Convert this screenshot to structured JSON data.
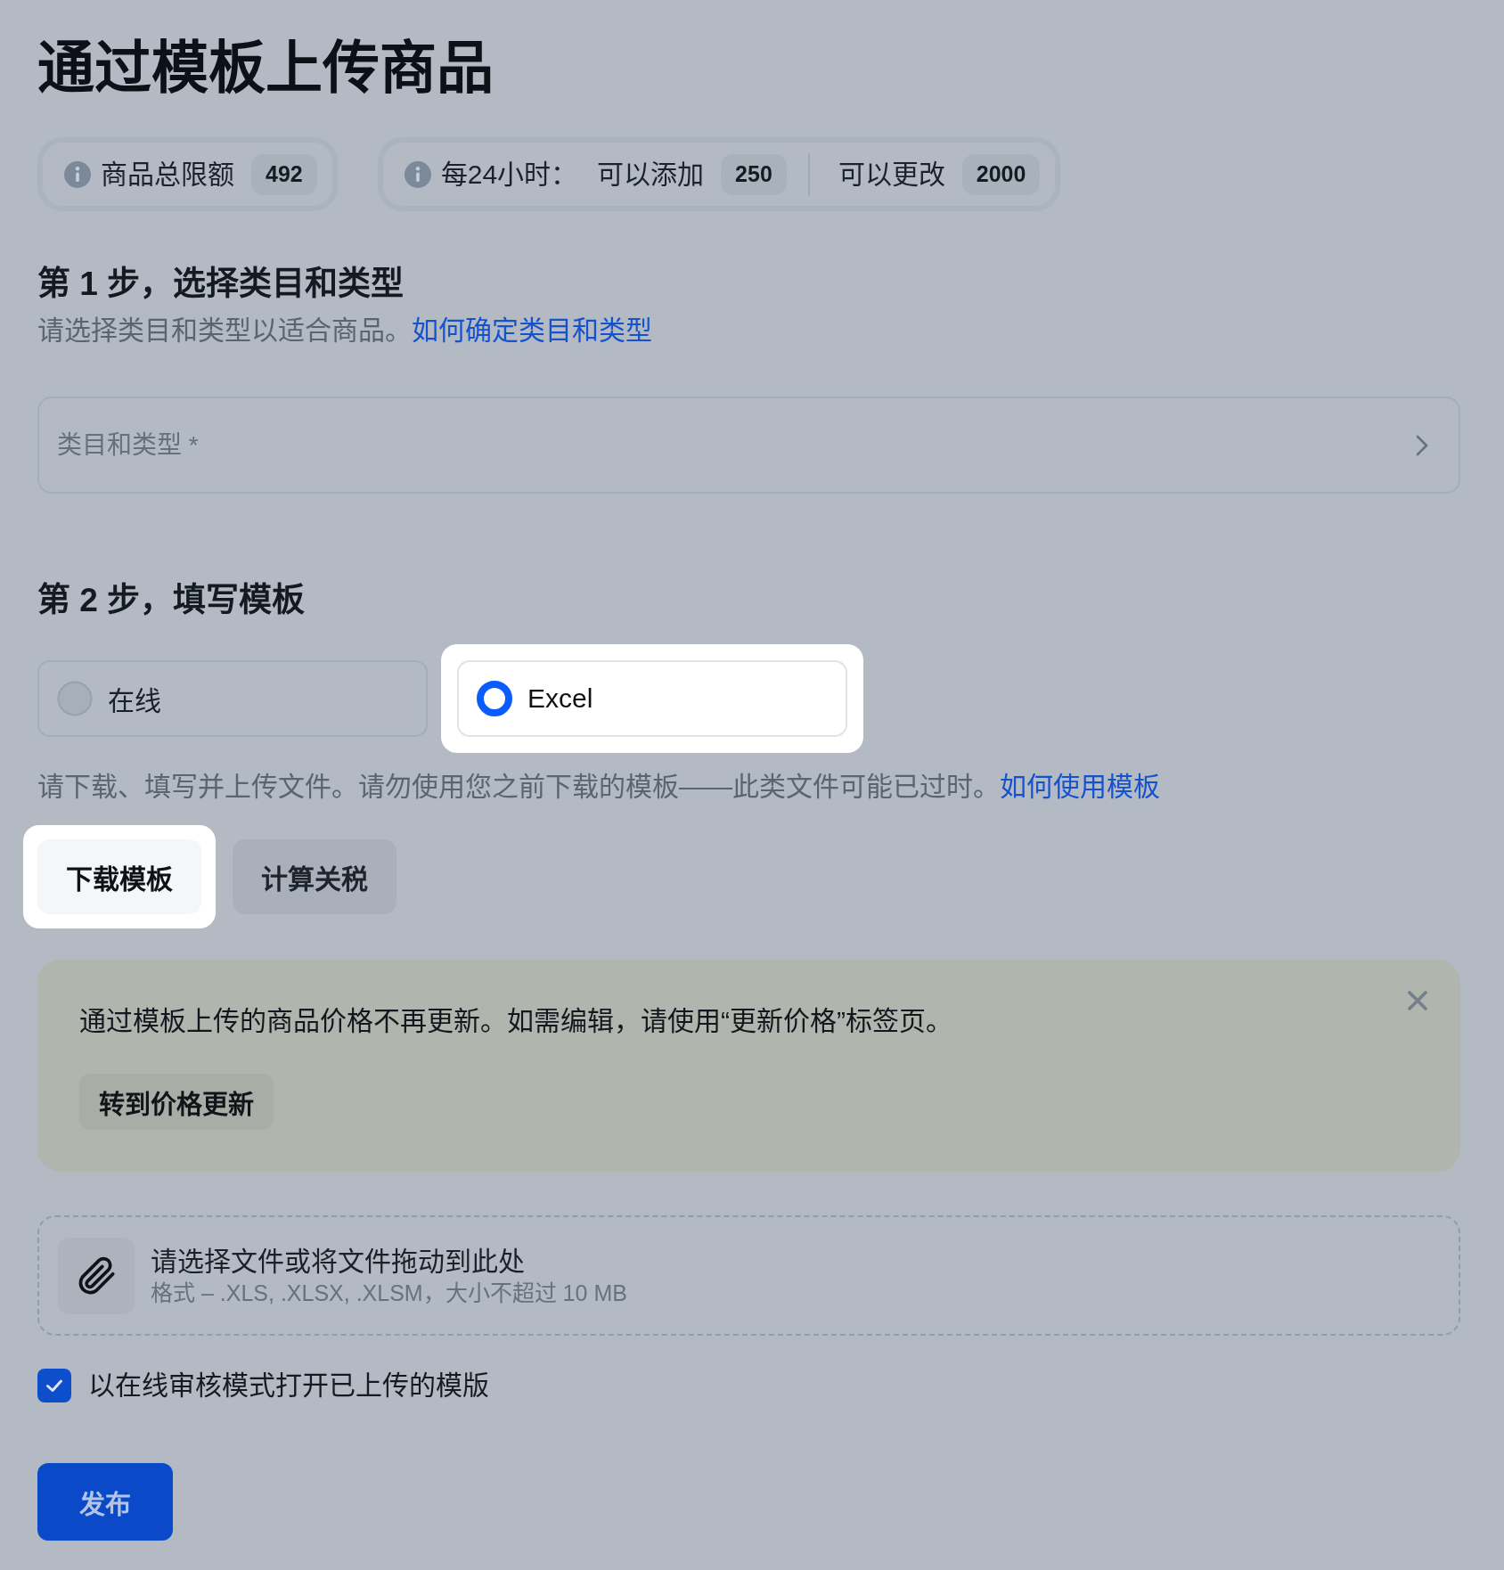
{
  "page": {
    "title": "通过模板上传商品"
  },
  "limits": [
    {
      "title": "商品总限额",
      "counters": [
        {
          "value": "492"
        }
      ]
    },
    {
      "title": "每24小时：",
      "counters": [
        {
          "label": "可以添加",
          "value": "250"
        },
        {
          "label": "可以更改",
          "value": "2000"
        }
      ]
    }
  ],
  "step_1": {
    "heading": "第 1 步，选择类目和类型",
    "description": "请选择类目和类型以适合商品。",
    "help_link": "如何确定类目和类型",
    "category_field": {
      "placeholder": "类目和类型 *"
    }
  },
  "step_2": {
    "heading": "第 2 步，填写模板",
    "options": [
      {
        "label": "在线",
        "selected": false,
        "highlighted": false
      },
      {
        "label": "Excel",
        "selected": true,
        "highlighted": true
      }
    ],
    "description": "请下载、填写并上传文件。请勿使用您之前下载的模板——此类文件可能已过时。",
    "help_link": "如何使用模板",
    "buttons": [
      {
        "label": "下载模板",
        "highlighted": true
      },
      {
        "label": "计算关税",
        "highlighted": false
      }
    ]
  },
  "notice": {
    "text": "通过模板上传的商品价格不再更新。如需编辑，请使用“更新价格”标签页。",
    "action": "转到价格更新"
  },
  "upload": {
    "title": "请选择文件或将文件拖动到此处",
    "hint": "格式 – .XLS, .XLSX, .XLSM，大小不超过 10 MB"
  },
  "review_checkbox": {
    "label": "以在线审核模式打开已上传的模版",
    "checked": true
  },
  "publish_button": {
    "label": "发布"
  }
}
